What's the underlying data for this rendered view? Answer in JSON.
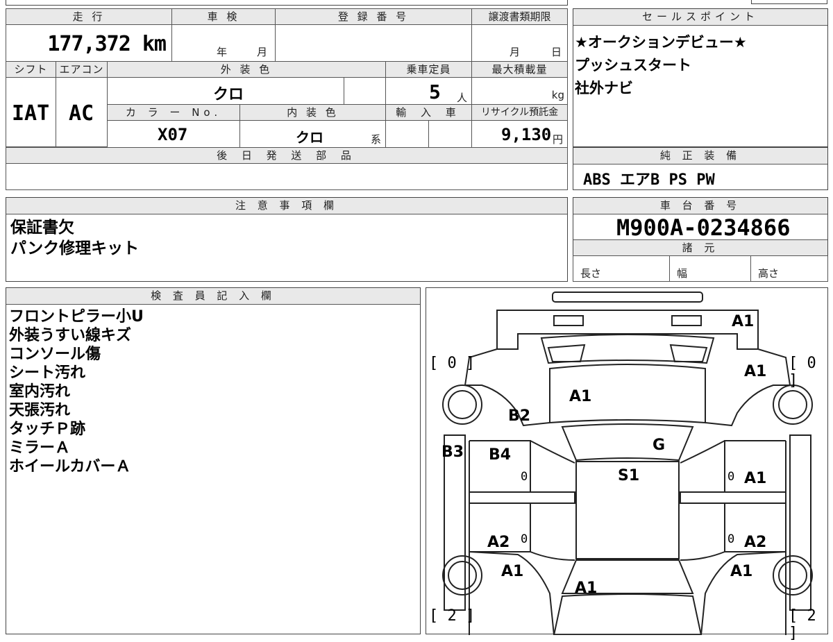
{
  "top_left": {
    "mileage_label": "走 行",
    "mileage_value": "177,372 km",
    "inspection_label": "車 検",
    "inspection_year": "年",
    "inspection_month": "月",
    "registration_label": "登 録 番 号",
    "transfer_label": "譲渡書類期限",
    "transfer_month": "月",
    "transfer_day": "日",
    "shift_label": "シフト",
    "shift_value": "IAT",
    "ac_label": "エアコン",
    "ac_value": "AC",
    "exterior_color_label": "外 装 色",
    "exterior_color_value": "クロ",
    "capacity_label": "乗車定員",
    "capacity_value": "5",
    "capacity_unit": "人",
    "max_load_label": "最大積載量",
    "max_load_unit": "kg",
    "color_no_label": "カ ラ ー No.",
    "color_no_value": "X07",
    "interior_color_label": "内 装 色",
    "interior_color_value": "クロ",
    "interior_color_suffix": "系",
    "import_label": "輸 入 車",
    "recycle_label": "リサイクル預託金",
    "recycle_value": "9,130",
    "recycle_unit": "円",
    "later_parts_label": "後 日 発 送 部 品"
  },
  "sales_points": {
    "label": "セールスポイント",
    "lines": [
      "★オークションデビュー★",
      "プッシュスタート",
      "社外ナビ"
    ]
  },
  "genuine_equipment": {
    "label": "純 正 装 備",
    "value": "ABS エアB PS PW"
  },
  "caution": {
    "label": "注 意 事 項 欄",
    "lines": [
      "保証書欠",
      "パンク修理キット"
    ]
  },
  "chassis": {
    "label": "車 台 番 号",
    "value": "M900A-0234866",
    "specs_label": "諸 元",
    "length_label": "長さ",
    "width_label": "幅",
    "height_label": "高さ"
  },
  "inspector": {
    "label": "検 査 員 記 入 欄",
    "lines": [
      "フロントピラー小U",
      "外装うすい線キズ",
      "コンソール傷",
      "シート汚れ",
      "室内汚れ",
      "天張汚れ",
      "タッチＰ跡",
      "ミラーＡ",
      "ホイールカバーＡ"
    ]
  },
  "diagram": {
    "tire_ratings": {
      "front_left": "[ 0 ]",
      "front_right": "[ 0 ]",
      "rear_left": "[ 2 ]",
      "rear_right": "[ 2 ]"
    },
    "marks": {
      "front_bumper": "A1",
      "front_right_fender": "A1",
      "hood": "A1",
      "left_pillar": "B2",
      "left_step": "B3",
      "left_front_door": "B4",
      "windshield_area": "G",
      "roof": "S1",
      "right_front_door": "A1",
      "left_rear_door": "A2",
      "right_rear_door": "A2",
      "left_rear_fender": "A1",
      "right_rear_fender": "A1",
      "rear": "A1"
    },
    "door_zeros": [
      "0",
      "0",
      "0",
      "0"
    ]
  }
}
